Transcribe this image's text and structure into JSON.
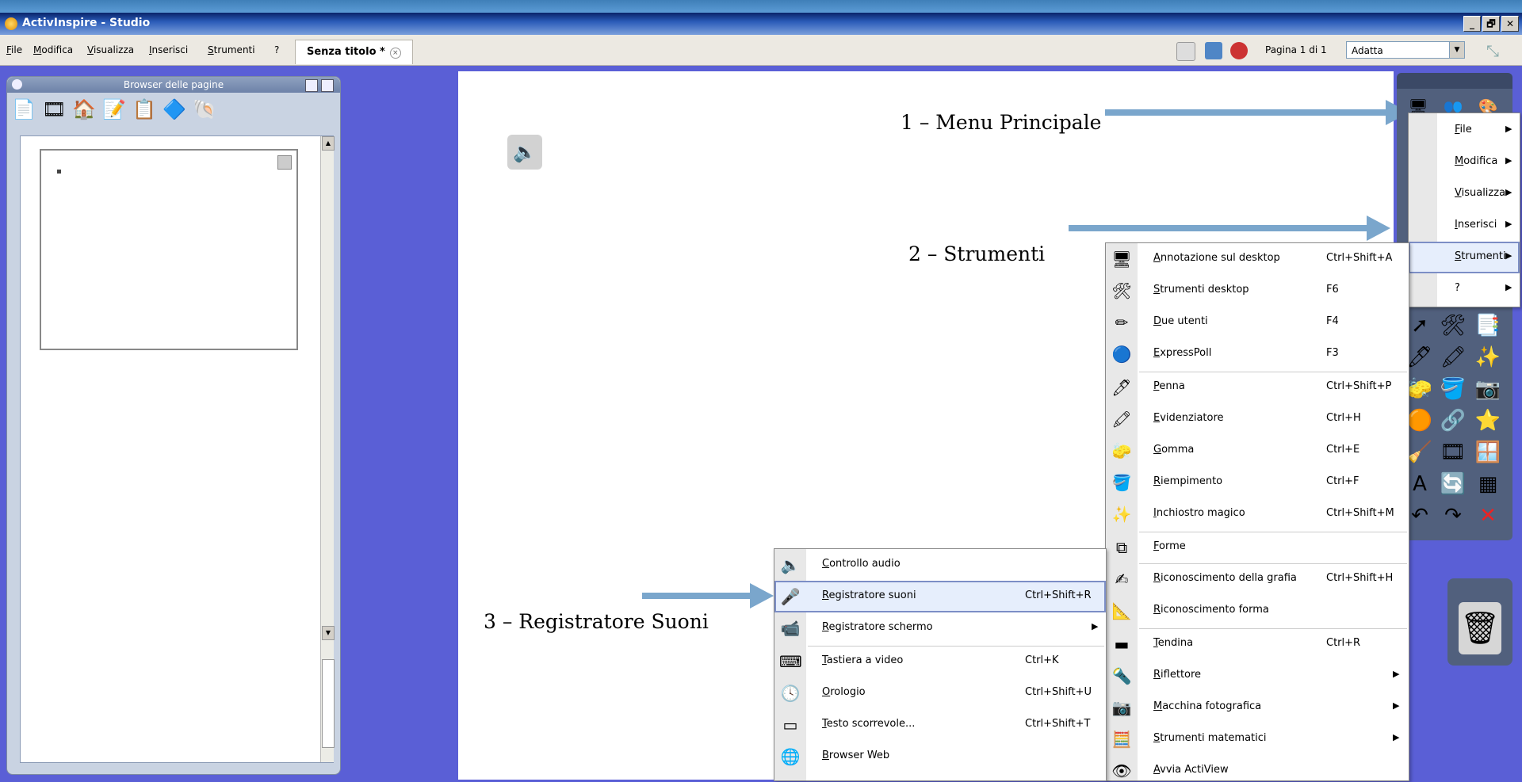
{
  "window": {
    "title": "ActivInspire - Studio",
    "controls": [
      "_",
      "🗗",
      "✕"
    ]
  },
  "menubar": {
    "items": [
      "File",
      "Modifica",
      "Visualizza",
      "Inserisci",
      "Strumenti",
      "?"
    ]
  },
  "document_tab": {
    "label": "Senza titolo *",
    "close_glyph": "×"
  },
  "page_indicator": {
    "label": "Pagina 1 di 1"
  },
  "zoom": {
    "value": "Adatta",
    "dropdown_glyph": "▼"
  },
  "page_browser": {
    "title": "Browser delle pagine",
    "icons": [
      "pages-icon",
      "resources-icon",
      "objects-icon",
      "notes-icon",
      "properties-icon",
      "actions-icon",
      "voting-icon"
    ]
  },
  "annotations": {
    "a1": "1 – Menu Principale",
    "a2": "2 – Strumenti",
    "a3": "3 – Registratore Suoni"
  },
  "main_menu": {
    "items": [
      {
        "label": "File",
        "has_sub": true
      },
      {
        "label": "Modifica",
        "has_sub": true
      },
      {
        "label": "Visualizza",
        "has_sub": true
      },
      {
        "label": "Inserisci",
        "has_sub": true
      },
      {
        "label": "Strumenti",
        "has_sub": true,
        "highlighted": true
      },
      {
        "label": "?",
        "has_sub": true
      }
    ]
  },
  "tools_menu": {
    "items": [
      {
        "icon": "desktop-annotation-icon",
        "label": "Annotazione sul desktop",
        "shortcut": "Ctrl+Shift+A"
      },
      {
        "icon": "desktop-tools-icon",
        "label": "Strumenti desktop",
        "shortcut": "F6"
      },
      {
        "icon": "dual-user-icon",
        "label": "Due utenti",
        "shortcut": "F4"
      },
      {
        "icon": "expresspoll-icon",
        "label": "ExpressPoll",
        "shortcut": "F3"
      },
      {
        "icon": "pen-icon",
        "label": "Penna",
        "shortcut": "Ctrl+Shift+P"
      },
      {
        "icon": "highlighter-icon",
        "label": "Evidenziatore",
        "shortcut": "Ctrl+H"
      },
      {
        "icon": "eraser-icon",
        "label": "Gomma",
        "shortcut": "Ctrl+E"
      },
      {
        "icon": "fill-icon",
        "label": "Riempimento",
        "shortcut": "Ctrl+F"
      },
      {
        "icon": "magic-ink-icon",
        "label": "Inchiostro magico",
        "shortcut": "Ctrl+Shift+M"
      },
      {
        "icon": "shapes-icon",
        "label": "Forme",
        "shortcut": ""
      },
      {
        "icon": "handwriting-recognition-icon",
        "label": "Riconoscimento della grafia",
        "shortcut": "Ctrl+Shift+H"
      },
      {
        "icon": "shape-recognition-icon",
        "label": "Riconoscimento forma",
        "shortcut": ""
      },
      {
        "icon": "curtain-icon",
        "label": "Tendina",
        "shortcut": "Ctrl+R"
      },
      {
        "icon": "spotlight-icon",
        "label": "Riflettore",
        "shortcut": "",
        "has_sub": true
      },
      {
        "icon": "camera-icon",
        "label": "Macchina fotografica",
        "shortcut": "",
        "has_sub": true
      },
      {
        "icon": "math-tools-icon",
        "label": "Strumenti matematici",
        "shortcut": "",
        "has_sub": true
      },
      {
        "icon": "activview-icon",
        "label": "Avvia ActiView",
        "shortcut": ""
      }
    ]
  },
  "more_tools_menu": {
    "items": [
      {
        "icon": "audio-control-icon",
        "label": "Controllo audio",
        "shortcut": ""
      },
      {
        "icon": "sound-recorder-icon",
        "label": "Registratore suoni",
        "shortcut": "Ctrl+Shift+R",
        "highlighted": true
      },
      {
        "icon": "screen-recorder-icon",
        "label": "Registratore schermo",
        "shortcut": "",
        "has_sub": true
      },
      {
        "icon": "keyboard-icon",
        "label": "Tastiera a video",
        "shortcut": "Ctrl+K"
      },
      {
        "icon": "clock-icon",
        "label": "Orologio",
        "shortcut": "Ctrl+Shift+U"
      },
      {
        "icon": "ticker-icon",
        "label": "Testo scorrevole...",
        "shortcut": "Ctrl+Shift+T"
      },
      {
        "icon": "web-browser-icon",
        "label": "Browser Web",
        "shortcut": ""
      }
    ]
  },
  "colors": {
    "canvas_bg": "#5a5fd6",
    "arrow": "#7aa6cc",
    "toolbox": "#51607d"
  }
}
